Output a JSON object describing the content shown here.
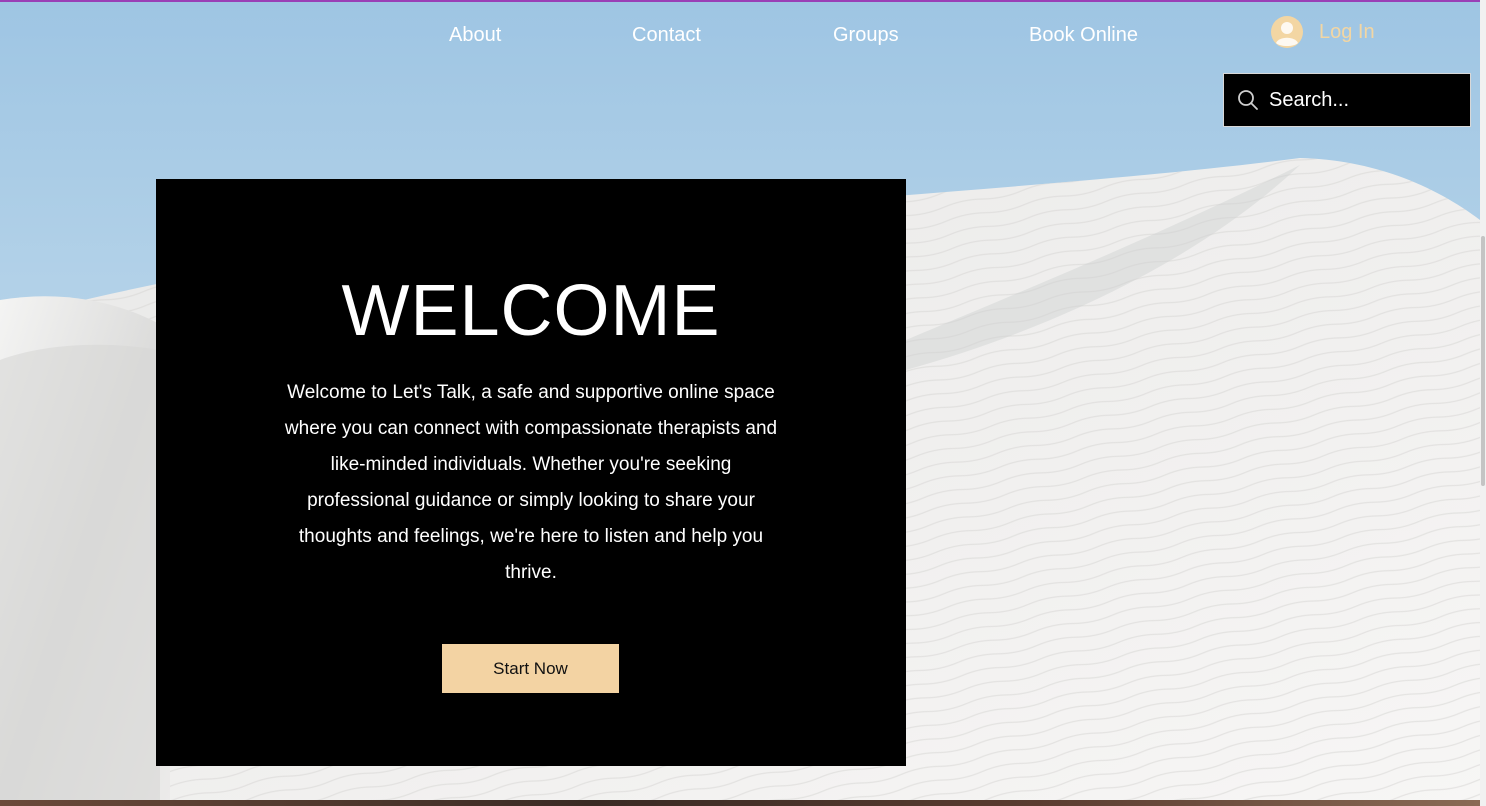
{
  "nav": {
    "items": [
      {
        "label": "About"
      },
      {
        "label": "Contact"
      },
      {
        "label": "Groups"
      },
      {
        "label": "Book Online"
      }
    ],
    "login_label": "Log In"
  },
  "search": {
    "placeholder": "Search..."
  },
  "hero": {
    "title": "WELCOME",
    "body": "Welcome to Let's Talk, a safe and supportive online space where you can connect with compassionate therapists and like-minded individuals. Whether you're seeking professional guidance or simply looking to share your thoughts and feelings, we're here to listen and help you thrive.",
    "cta_label": "Start Now"
  },
  "icons": {
    "login": "user-avatar-icon",
    "search": "magnifier-icon"
  },
  "colors": {
    "accent_gold": "#f3d3a3",
    "login_text": "#f3d6a3",
    "card_background": "#000000",
    "sky": "#a9cbe3",
    "top_accent": "#9a3fb6"
  }
}
